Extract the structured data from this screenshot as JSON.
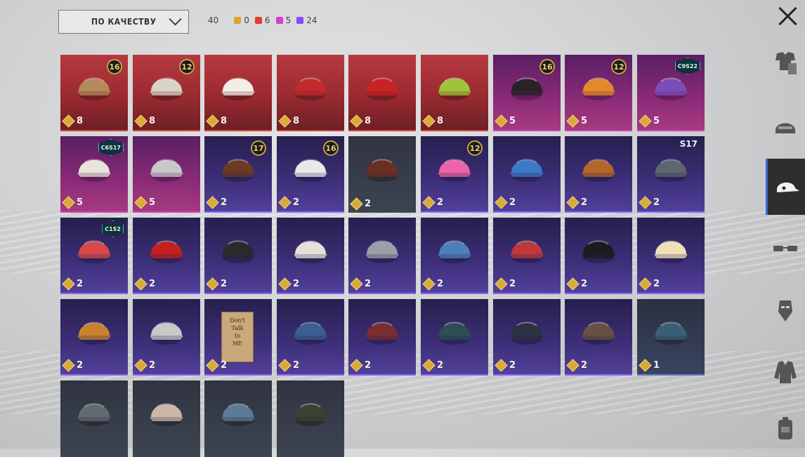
{
  "sort": {
    "label": "ПО КАЧЕСТВУ"
  },
  "counts": {
    "total": "40",
    "items": [
      {
        "value": "0",
        "color": "#e0a032"
      },
      {
        "value": "6",
        "color": "#e23a3a"
      },
      {
        "value": "5",
        "color": "#d63fd0"
      },
      {
        "value": "24",
        "color": "#7f4cff"
      }
    ]
  },
  "sidebar": {
    "items": [
      {
        "icon": "outfit-icon",
        "active": false
      },
      {
        "icon": "helmet-icon",
        "active": false
      },
      {
        "icon": "cap-icon",
        "active": true
      },
      {
        "icon": "glasses-icon",
        "active": false
      },
      {
        "icon": "mask-icon",
        "active": false
      },
      {
        "icon": "jacket-icon",
        "active": false
      },
      {
        "icon": "backpack-icon",
        "active": false
      }
    ]
  },
  "items": [
    {
      "rarity": "red",
      "qty": "8",
      "badge": "16",
      "art": "frog-bucket-hat"
    },
    {
      "rarity": "red",
      "qty": "8",
      "badge": "12",
      "art": "white-hair"
    },
    {
      "rarity": "red",
      "qty": "8",
      "badge": "",
      "art": "white-cowboy-hat"
    },
    {
      "rarity": "red",
      "qty": "8",
      "badge": "",
      "art": "red-helmet"
    },
    {
      "rarity": "red",
      "qty": "8",
      "badge": "",
      "art": "demon-mask"
    },
    {
      "rarity": "red",
      "qty": "8",
      "badge": "",
      "art": "clown-green-hair"
    },
    {
      "rarity": "pink",
      "qty": "5",
      "badge": "16",
      "art": "black-hair"
    },
    {
      "rarity": "pink",
      "qty": "5",
      "badge": "12",
      "art": "orange-hair"
    },
    {
      "rarity": "pink",
      "qty": "5",
      "badge": "C9S22",
      "art": "purple-hair"
    },
    {
      "rarity": "pink",
      "qty": "5",
      "badge": "C6S17",
      "art": "yellow-visor"
    },
    {
      "rarity": "pink",
      "qty": "5",
      "badge": "",
      "art": "goggles-hair"
    },
    {
      "rarity": "purple",
      "qty": "2",
      "badge": "17",
      "art": "spiked-helmet"
    },
    {
      "rarity": "purple",
      "qty": "2",
      "badge": "16",
      "art": "white-cap-visor"
    },
    {
      "rarity": "gray",
      "qty": "2",
      "badge": "",
      "art": "brown-hair"
    },
    {
      "rarity": "purple",
      "qty": "2",
      "badge": "12",
      "art": "bunny-ears"
    },
    {
      "rarity": "purple",
      "qty": "2",
      "badge": "",
      "art": "blue-cap"
    },
    {
      "rarity": "purple",
      "qty": "2",
      "badge": "",
      "art": "brown-beanie"
    },
    {
      "rarity": "purple",
      "qty": "2",
      "badge": "S17",
      "art": "horned-helmet"
    },
    {
      "rarity": "purple",
      "qty": "2",
      "badge": "C1S2",
      "art": "striped-beanie"
    },
    {
      "rarity": "purple",
      "qty": "2",
      "badge": "",
      "art": "red-mohawk"
    },
    {
      "rarity": "purple",
      "qty": "2",
      "badge": "",
      "art": "gas-mask"
    },
    {
      "rarity": "purple",
      "qty": "2",
      "badge": "",
      "art": "kabuki-mask"
    },
    {
      "rarity": "purple",
      "qty": "2",
      "badge": "",
      "art": "silver-helmet"
    },
    {
      "rarity": "purple",
      "qty": "2",
      "badge": "",
      "art": "shark-hat"
    },
    {
      "rarity": "purple",
      "qty": "2",
      "badge": "",
      "art": "red-beret"
    },
    {
      "rarity": "purple",
      "qty": "2",
      "badge": "",
      "art": "black-top-hat"
    },
    {
      "rarity": "purple",
      "qty": "2",
      "badge": "",
      "art": "cake-hat"
    },
    {
      "rarity": "purple",
      "qty": "2",
      "badge": "",
      "art": "burger-hat"
    },
    {
      "rarity": "purple",
      "qty": "2",
      "badge": "",
      "art": "head-mirror"
    },
    {
      "rarity": "purple",
      "qty": "2",
      "badge": "",
      "art": "cardboard-sign",
      "sign": "Don't\nTalk\nto\nME"
    },
    {
      "rarity": "purple",
      "qty": "2",
      "badge": "",
      "art": "blue-cap-small"
    },
    {
      "rarity": "purple",
      "qty": "2",
      "badge": "",
      "art": "fedora"
    },
    {
      "rarity": "purple",
      "qty": "2",
      "badge": "",
      "art": "checkered-helmet"
    },
    {
      "rarity": "purple",
      "qty": "2",
      "badge": "",
      "art": "bucket-hat"
    },
    {
      "rarity": "purple",
      "qty": "2",
      "badge": "",
      "art": "aviator-cap"
    },
    {
      "rarity": "blue",
      "qty": "1",
      "badge": "",
      "art": "teal-beret"
    },
    {
      "rarity": "gray",
      "qty": "",
      "badge": "",
      "art": "gray-beret"
    },
    {
      "rarity": "gray",
      "qty": "",
      "badge": "",
      "art": "trucker-cap"
    },
    {
      "rarity": "gray",
      "qty": "",
      "badge": "",
      "art": "trucker-cap-blue"
    },
    {
      "rarity": "gray",
      "qty": "",
      "badge": "",
      "art": "camo-cap"
    }
  ]
}
